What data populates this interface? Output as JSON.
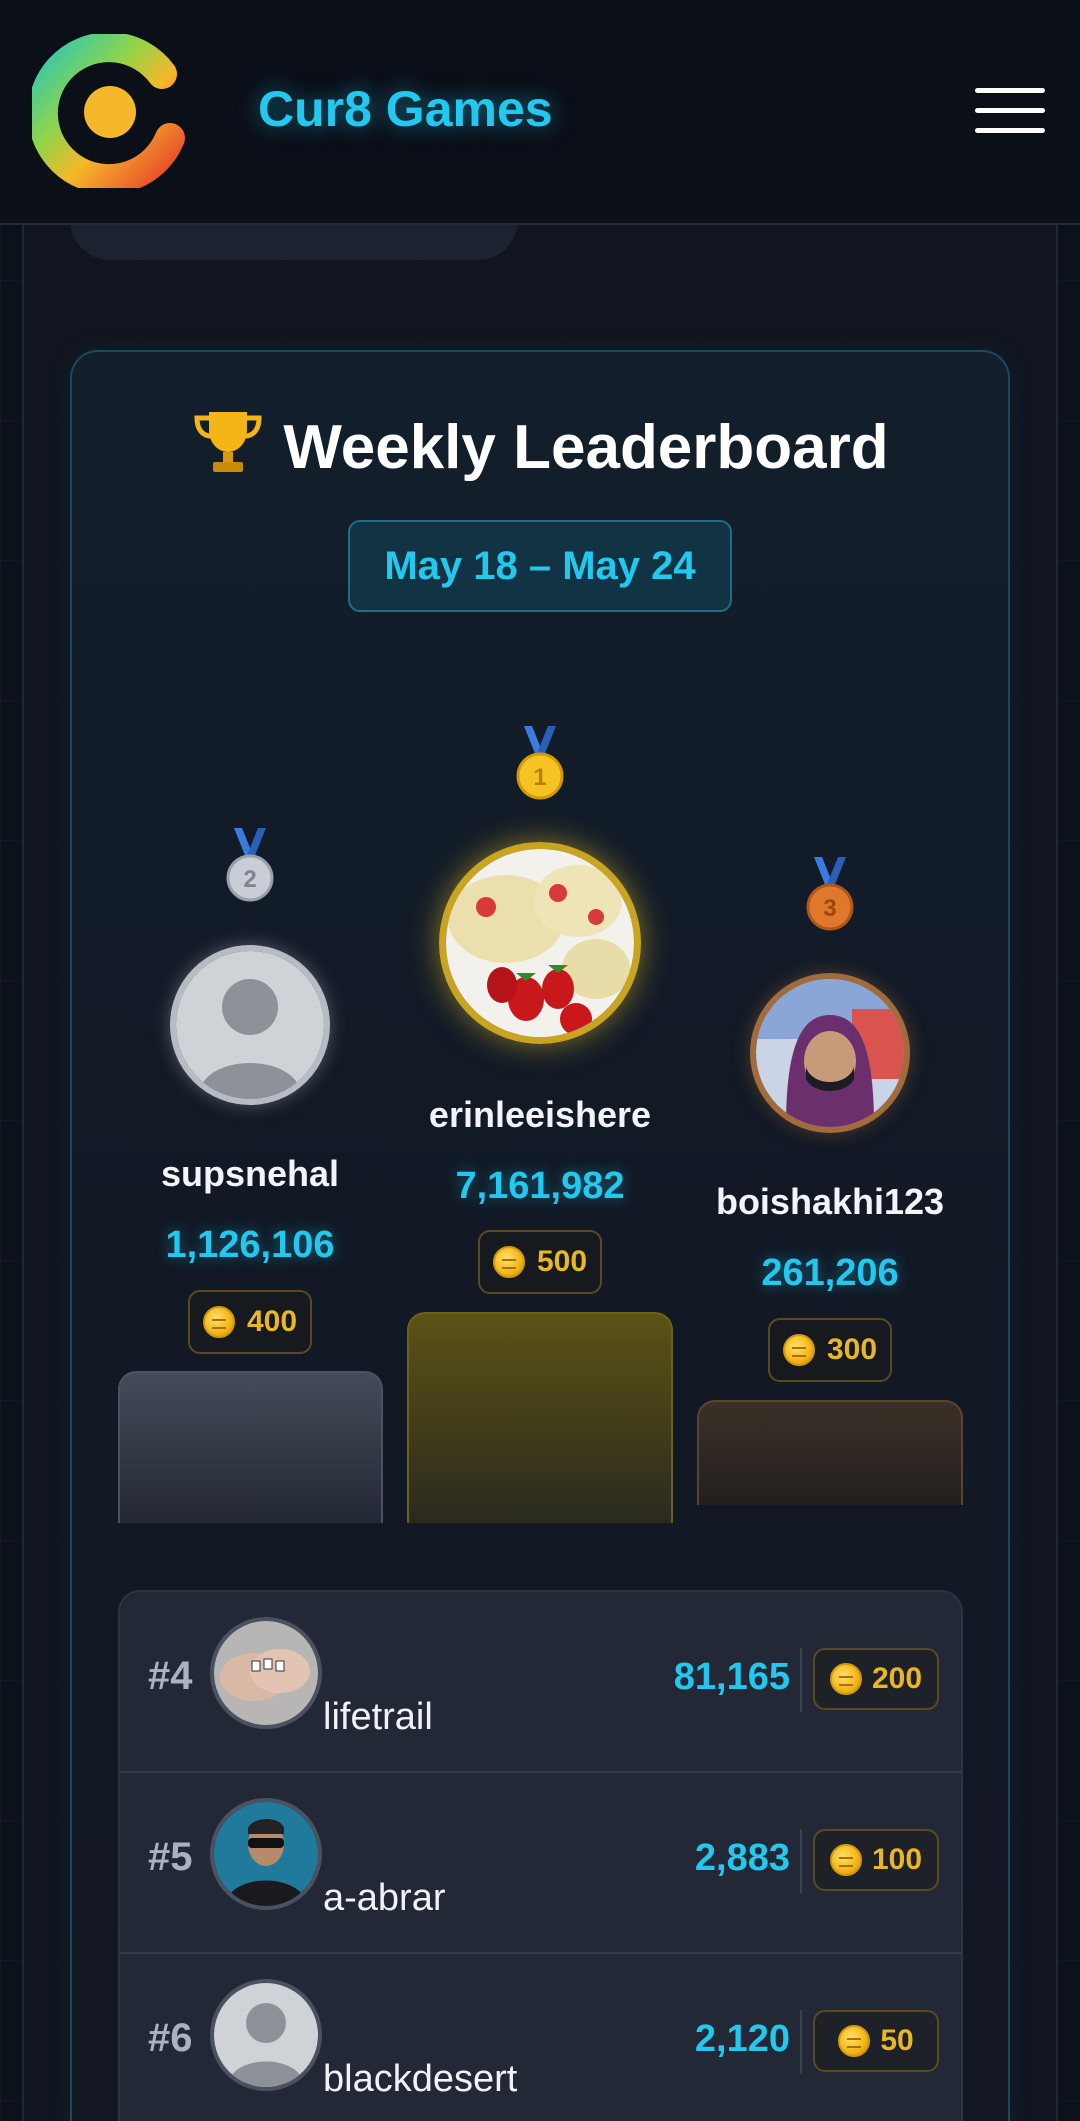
{
  "header": {
    "brand": "Cur8 Games",
    "menu_label": "Menu"
  },
  "leaderboard": {
    "title": "Weekly Leaderboard",
    "date_range": "May 18 – May 24",
    "podium": [
      {
        "place": 2,
        "medal": "silver-medal-icon",
        "name": "supsnehal",
        "score": "1,126,106",
        "coins": "400"
      },
      {
        "place": 1,
        "medal": "gold-medal-icon",
        "name": "erinleeishere",
        "score": "7,161,982",
        "coins": "500"
      },
      {
        "place": 3,
        "medal": "bronze-medal-icon",
        "name": "boishakhi123",
        "score": "261,206",
        "coins": "300"
      }
    ],
    "rows": [
      {
        "rank": "#4",
        "name": "lifetrail",
        "score": "81,165",
        "coins": "200"
      },
      {
        "rank": "#5",
        "name": "a-abrar",
        "score": "2,883",
        "coins": "100"
      },
      {
        "rank": "#6",
        "name": "blackdesert",
        "score": "2,120",
        "coins": "50"
      }
    ]
  },
  "colors": {
    "accent": "#22c8ee",
    "gold": "#e9b628",
    "background": "#0d1119"
  }
}
